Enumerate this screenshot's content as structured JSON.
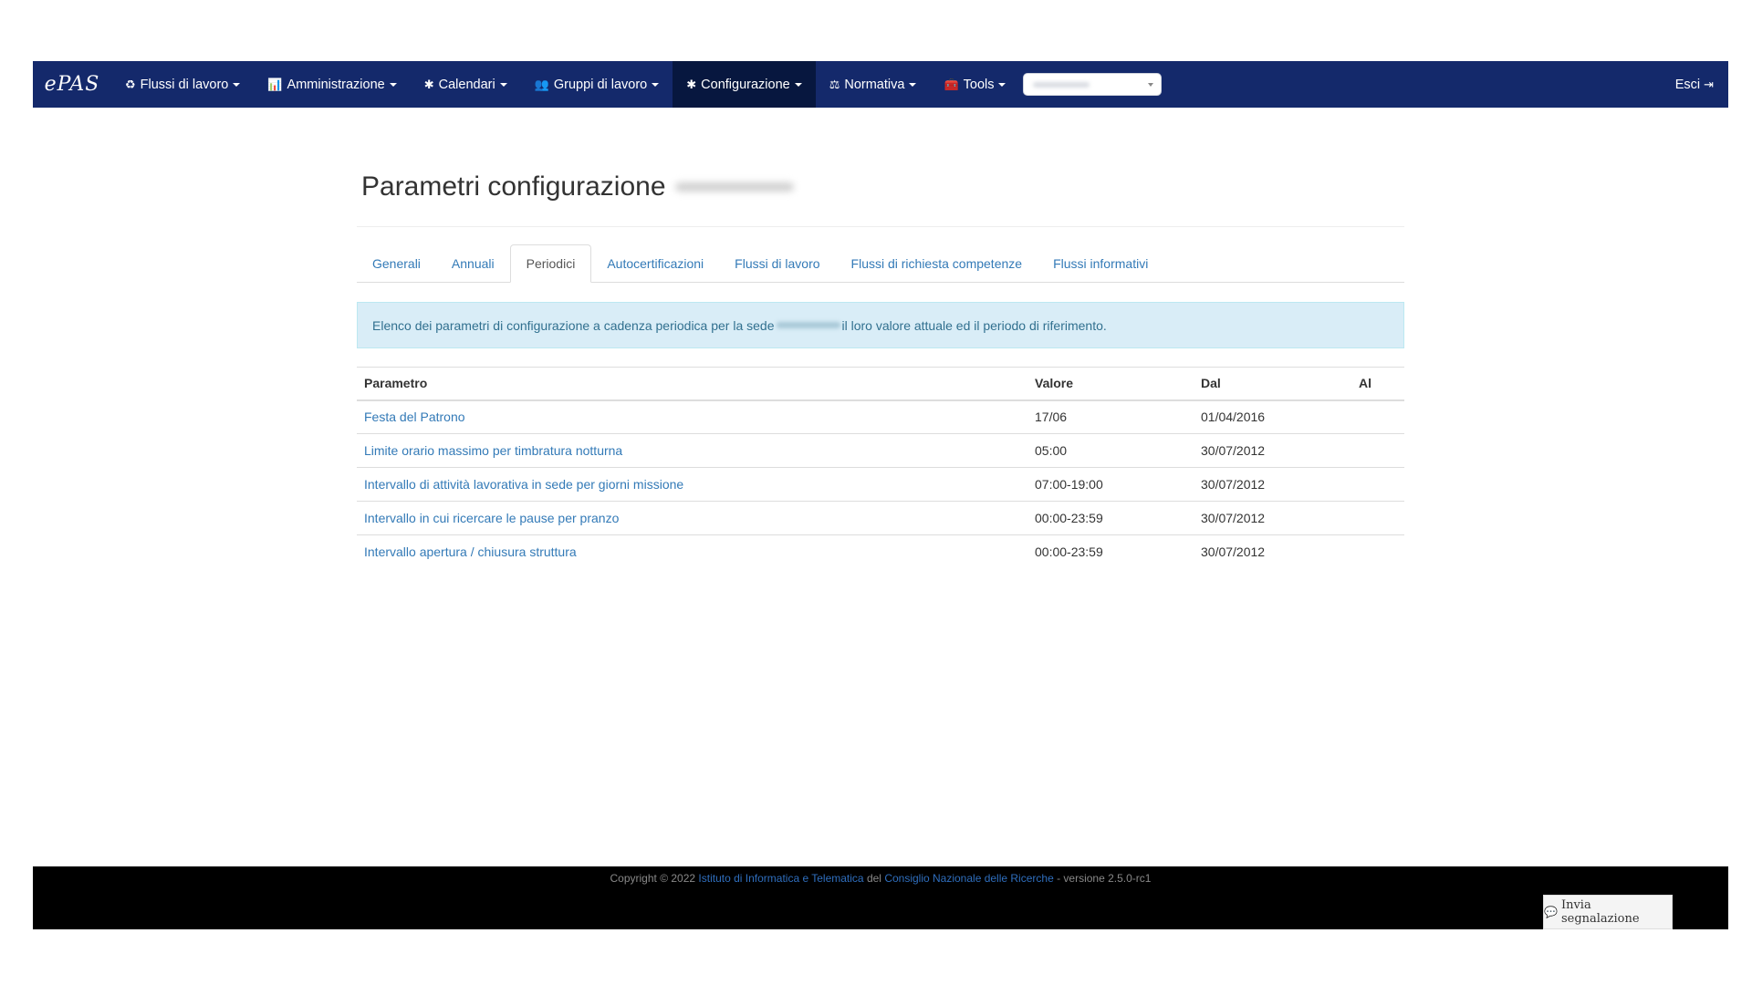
{
  "navbar": {
    "brand": "ePAS",
    "items": [
      {
        "icon": "recycle-icon",
        "glyph": "♻",
        "label": "Flussi di lavoro"
      },
      {
        "icon": "bar-chart-icon",
        "glyph": "📊",
        "label": "Amministrazione"
      },
      {
        "icon": "gear-icon",
        "glyph": "✱",
        "label": "Calendari"
      },
      {
        "icon": "users-icon",
        "glyph": "👥",
        "label": "Gruppi di lavoro"
      },
      {
        "icon": "gear-icon",
        "glyph": "✱",
        "label": "Configurazione"
      },
      {
        "icon": "balance-scale-icon",
        "glyph": "⚖",
        "label": "Normativa"
      },
      {
        "icon": "toolbox-icon",
        "glyph": "🧰",
        "label": "Tools"
      }
    ],
    "logout": {
      "label": "Esci",
      "glyph": "⇥"
    }
  },
  "page": {
    "title": "Parametri configurazione"
  },
  "tabs": [
    "Generali",
    "Annuali",
    "Periodici",
    "Autocertificazioni",
    "Flussi di lavoro",
    "Flussi di richiesta competenze",
    "Flussi informativi"
  ],
  "alert": {
    "before": "Elenco dei parametri di configurazione a cadenza periodica per la sede",
    "after": "il loro valore attuale ed il periodo di riferimento."
  },
  "table": {
    "headers": {
      "param": "Parametro",
      "value": "Valore",
      "from": "Dal",
      "to": "Al"
    },
    "rows": [
      {
        "param": "Festa del Patrono",
        "value": "17/06",
        "from": "01/04/2016",
        "to": ""
      },
      {
        "param": "Limite orario massimo per timbratura notturna",
        "value": "05:00",
        "from": "30/07/2012",
        "to": ""
      },
      {
        "param": "Intervallo di attività lavorativa in sede per giorni missione",
        "value": "07:00-19:00",
        "from": "30/07/2012",
        "to": ""
      },
      {
        "param": "Intervallo in cui ricercare le pause per pranzo",
        "value": "00:00-23:59",
        "from": "30/07/2012",
        "to": ""
      },
      {
        "param": "Intervallo apertura / chiusura struttura",
        "value": "00:00-23:59",
        "from": "30/07/2012",
        "to": ""
      }
    ]
  },
  "footer": {
    "copyright": "Copyright © 2022",
    "institute": "Istituto di Informatica e Telematica",
    "del": "del",
    "council": "Consiglio Nazionale delle Ricerche",
    "version": "- versione 2.5.0-rc1",
    "report_button": "Invia segnalazione",
    "report_glyph": "💬"
  }
}
